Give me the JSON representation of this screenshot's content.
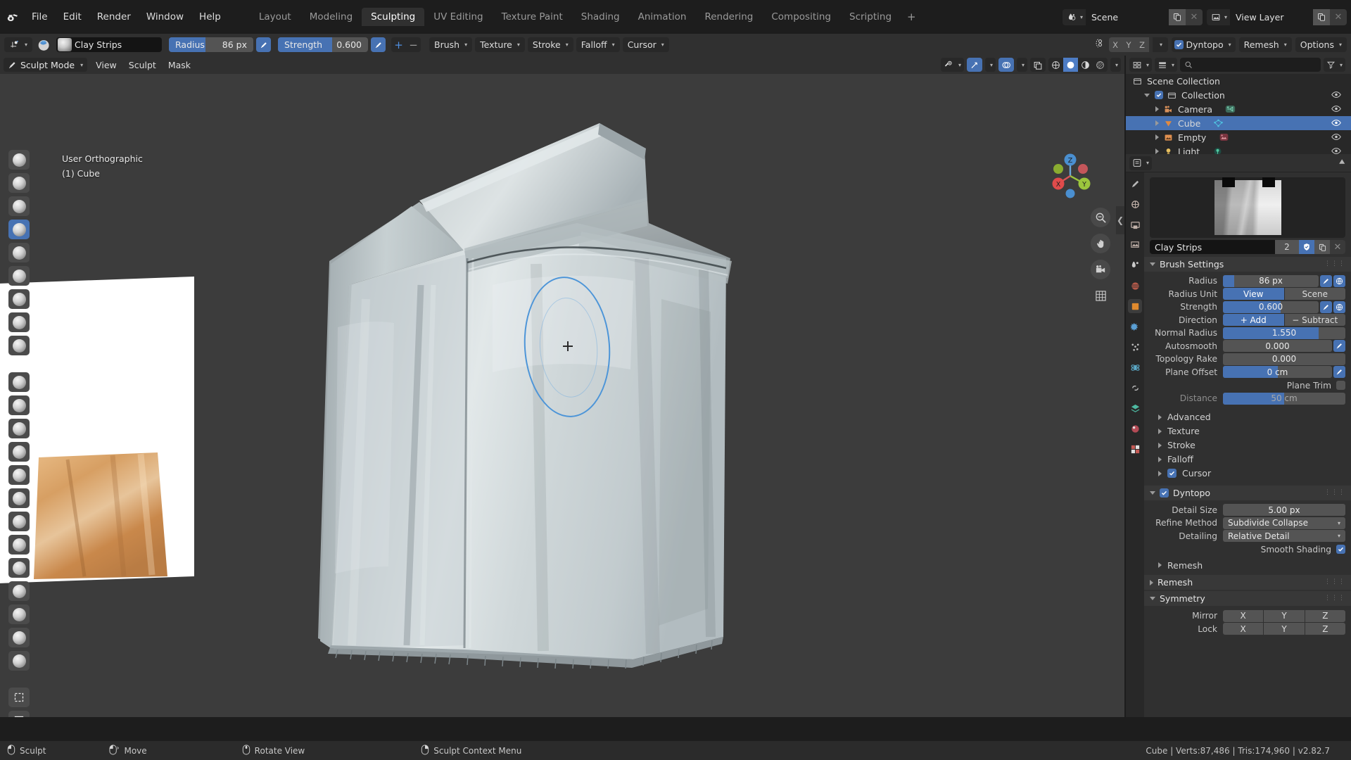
{
  "app": {
    "menus": [
      "File",
      "Edit",
      "Render",
      "Window",
      "Help"
    ],
    "workspace_tabs": [
      {
        "label": "Layout",
        "active": false
      },
      {
        "label": "Modeling",
        "active": false
      },
      {
        "label": "Sculpting",
        "active": true
      },
      {
        "label": "UV Editing",
        "active": false
      },
      {
        "label": "Texture Paint",
        "active": false
      },
      {
        "label": "Shading",
        "active": false
      },
      {
        "label": "Animation",
        "active": false
      },
      {
        "label": "Rendering",
        "active": false
      },
      {
        "label": "Compositing",
        "active": false
      },
      {
        "label": "Scripting",
        "active": false
      }
    ],
    "add_workspace": "+",
    "scene_name": "Scene",
    "view_layer_name": "View Layer"
  },
  "tool_settings": {
    "brush_name": "Clay Strips",
    "radius_label": "Radius",
    "radius_value": "86 px",
    "radius_fill_pct": 43,
    "strength_label": "Strength",
    "strength_value": "0.600",
    "strength_fill_pct": 60,
    "plus": "+",
    "minus": "−",
    "menus": [
      "Brush",
      "Texture",
      "Stroke",
      "Falloff",
      "Cursor"
    ],
    "symmetry_axes": [
      "X",
      "Y",
      "Z"
    ],
    "dyntopo_label": "Dyntopo",
    "dyntopo_enabled": true,
    "remesh_label": "Remesh",
    "options_label": "Options"
  },
  "viewport_header": {
    "mode": "Sculpt Mode",
    "menus": [
      "View",
      "Sculpt",
      "Mask"
    ]
  },
  "viewport": {
    "view_name": "User Orthographic",
    "object_label": "(1) Cube",
    "gizmo_axes": {
      "x": "X",
      "y": "Y",
      "z": "Z"
    }
  },
  "outliner": {
    "root": "Scene Collection",
    "items": [
      {
        "label": "Collection",
        "type": "collection",
        "depth": 1,
        "selected": false,
        "expanded": true
      },
      {
        "label": "Camera",
        "type": "camera",
        "depth": 2,
        "selected": false,
        "expanded": false
      },
      {
        "label": "Cube",
        "type": "mesh",
        "depth": 2,
        "selected": true,
        "expanded": false
      },
      {
        "label": "Empty",
        "type": "empty-image",
        "depth": 2,
        "selected": false,
        "expanded": false
      },
      {
        "label": "Light",
        "type": "light",
        "depth": 2,
        "selected": false,
        "expanded": false
      }
    ]
  },
  "properties": {
    "brush_datablock": {
      "name": "Clay Strips",
      "users": "2"
    },
    "brush_settings": {
      "title": "Brush Settings",
      "rows": [
        {
          "label": "Radius",
          "value": "86 px",
          "fill_pct": 12,
          "type": "slider",
          "pressure": true,
          "unified": true
        },
        {
          "label": "Radius Unit",
          "type": "segment",
          "options": [
            "View",
            "Scene"
          ],
          "selected": "View"
        },
        {
          "label": "Strength",
          "value": "0.600",
          "fill_pct": 60,
          "type": "slider",
          "pressure": true,
          "unified": true
        },
        {
          "label": "Direction",
          "type": "segment",
          "options": [
            "+  Add",
            "−  Subtract"
          ],
          "selected": "+  Add"
        },
        {
          "label": "Normal Radius",
          "value": "1.550",
          "fill_pct": 78,
          "type": "slider"
        },
        {
          "label": "Autosmooth",
          "value": "0.000",
          "fill_pct": 0,
          "type": "slider",
          "pressure": true
        },
        {
          "label": "Topology Rake",
          "value": "0.000",
          "fill_pct": 0,
          "type": "slider"
        },
        {
          "label": "Plane Offset",
          "value": "0 cm",
          "fill_pct": 50,
          "type": "slider",
          "pressure": true
        },
        {
          "label": "Plane Trim",
          "type": "checkbox",
          "checked": false
        },
        {
          "label": "Distance",
          "value": "50 cm",
          "fill_pct": 50,
          "type": "slider",
          "dim": true
        }
      ],
      "subpanels": [
        {
          "label": "Advanced",
          "expanded": false,
          "checkbox": null
        },
        {
          "label": "Texture",
          "expanded": false,
          "checkbox": null
        },
        {
          "label": "Stroke",
          "expanded": false,
          "checkbox": null
        },
        {
          "label": "Falloff",
          "expanded": false,
          "checkbox": null
        },
        {
          "label": "Cursor",
          "expanded": false,
          "checkbox": true
        }
      ]
    },
    "dyntopo": {
      "title": "Dyntopo",
      "enabled": true,
      "detail_size_label": "Detail Size",
      "detail_size_value": "5.00 px",
      "refine_method_label": "Refine Method",
      "refine_method_value": "Subdivide Collapse",
      "detailing_label": "Detailing",
      "detailing_value": "Relative Detail",
      "smooth_shading_label": "Smooth Shading",
      "smooth_shading_checked": true,
      "remesh_sub_label": "Remesh"
    },
    "remesh_panel": {
      "title": "Remesh"
    },
    "symmetry": {
      "title": "Symmetry",
      "mirror_label": "Mirror",
      "mirror_axes": [
        "X",
        "Y",
        "Z"
      ],
      "lock_label": "Lock",
      "lock_axes": [
        "X",
        "Y",
        "Z"
      ]
    }
  },
  "statusbar": {
    "hints": [
      {
        "icon": "mouse-left",
        "label": "Sculpt"
      },
      {
        "icon": "mouse-move",
        "label": "Move"
      },
      {
        "icon": "mouse-middle",
        "label": "Rotate View"
      },
      {
        "icon": "mouse-right",
        "label": "Sculpt Context Menu"
      }
    ],
    "scene_stats": "Cube | Verts:87,486 | Tris:174,960 | v2.82.7"
  },
  "colors": {
    "accent_blue": "#4772b3",
    "brush_cursor": "#4d95d8",
    "panel_bg": "#303030",
    "editor_bg": "#282828",
    "viewport_bg": "#3c3c3c"
  }
}
